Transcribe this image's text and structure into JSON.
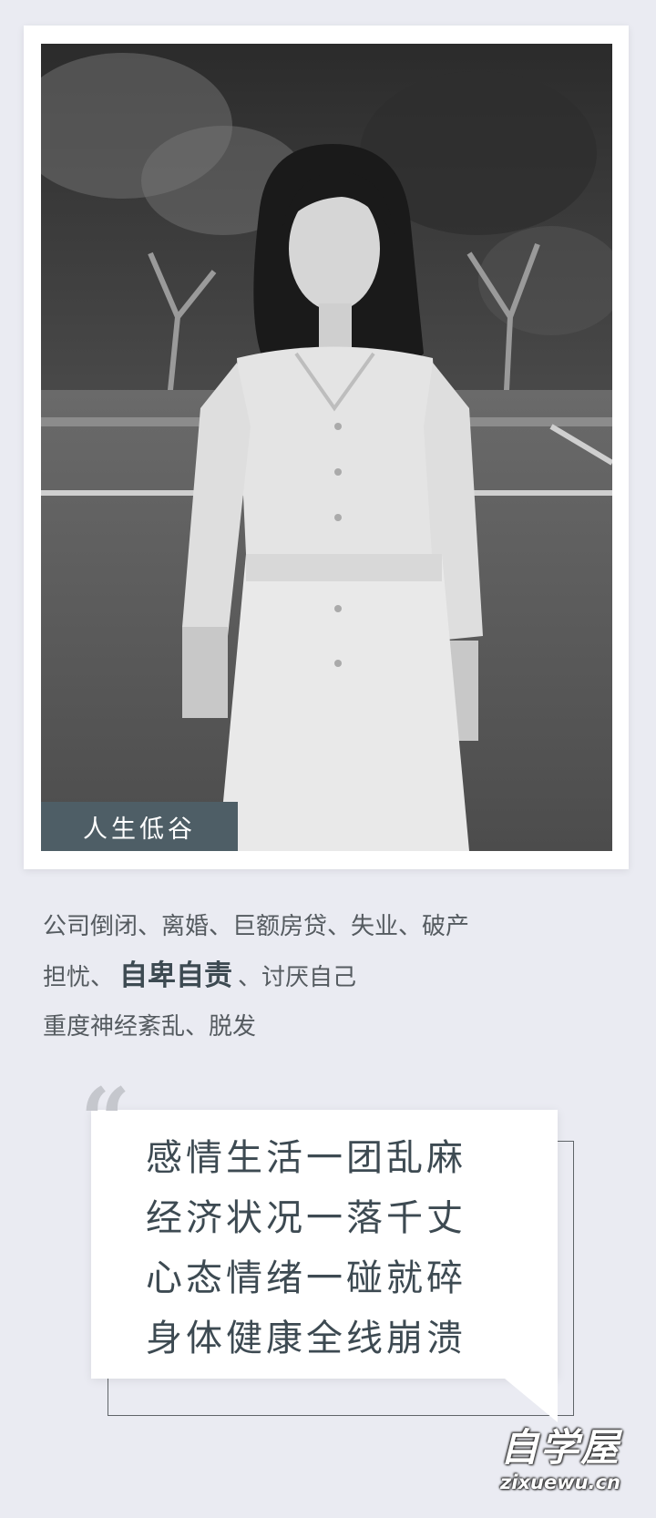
{
  "photo": {
    "tag": "人生低谷",
    "description": "Black-and-white portrait of a woman in a light button-up dress standing in an outdoor lot with trees behind"
  },
  "description": {
    "line1": "公司倒闭、离婚、巨额房贷、失业、破产",
    "line2_prefix": "担忧、",
    "line2_strong": "自卑自责",
    "line2_suffix": "、讨厌自己",
    "line3": "重度神经紊乱、脱发"
  },
  "quote": {
    "mark": "“",
    "lines": [
      "感情生活一团乱麻",
      "经济状况一落千丈",
      "心态情绪一碰就碎",
      "身体健康全线崩溃"
    ]
  },
  "watermark": {
    "logo": "自学屋",
    "url": "zixuewu.cn"
  },
  "colors": {
    "background": "#eaebf2",
    "tag_bg": "#4e5e66",
    "accent_text": "#3d4a52"
  }
}
